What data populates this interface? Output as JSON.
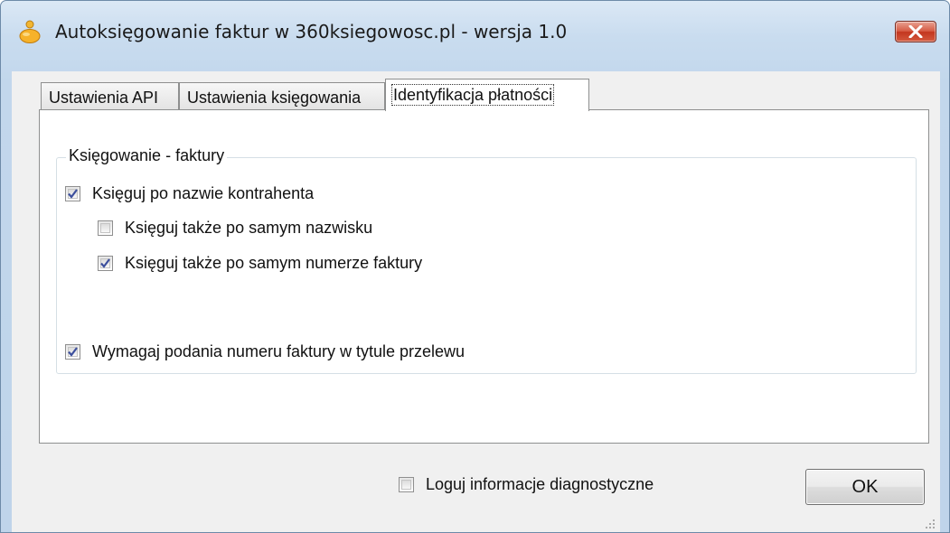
{
  "window": {
    "title": "Autoksięgowanie faktur w 360ksiegowosc.pl - wersja 1.0",
    "close_color": "#c7402a"
  },
  "tabs": [
    {
      "label": "Ustawienia API",
      "active": false
    },
    {
      "label": "Ustawienia księgowania",
      "active": false
    },
    {
      "label": "Identyfikacja płatności",
      "active": true
    }
  ],
  "group": {
    "title": "Księgowanie - faktury",
    "options": [
      {
        "label": "Księguj po nazwie kontrahenta",
        "checked": true
      },
      {
        "label": "Księguj także po samym nazwisku",
        "checked": false
      },
      {
        "label": "Księguj także po samym numerze faktury",
        "checked": true
      },
      {
        "label": "Wymagaj podania numeru faktury w tytule przelewu",
        "checked": true
      }
    ]
  },
  "footer": {
    "diagnostics_label": "Loguj informacje diagnostyczne",
    "diagnostics_checked": false,
    "ok_label": "OK"
  }
}
